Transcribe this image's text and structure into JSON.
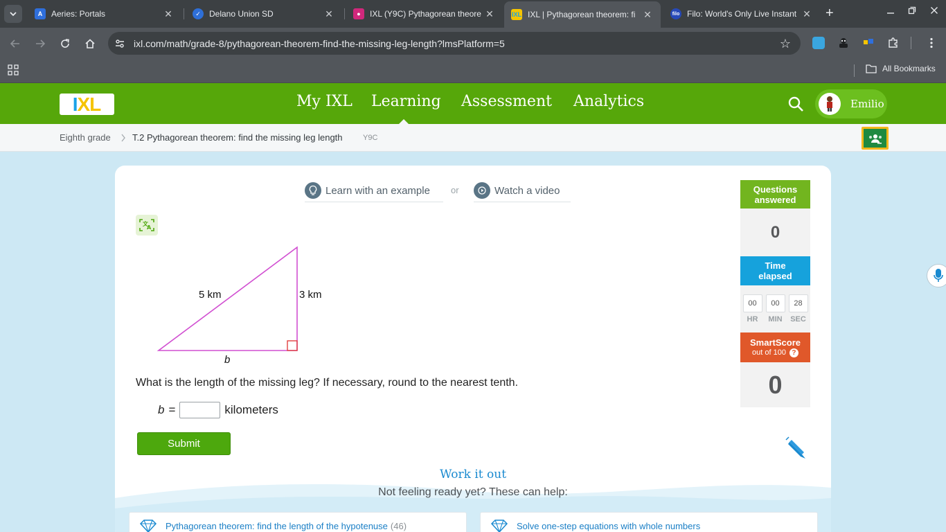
{
  "browser": {
    "tabs": [
      {
        "title": "Aeries: Portals",
        "active": false
      },
      {
        "title": "Delano Union SD",
        "active": false
      },
      {
        "title": "IXL (Y9C) Pythagorean theore",
        "active": false
      },
      {
        "title": "IXL | Pythagorean theorem: fi",
        "active": true
      },
      {
        "title": "Filo: World's Only Live Instant",
        "active": false
      }
    ],
    "url": "ixl.com/math/grade-8/pythagorean-theorem-find-the-missing-leg-length?lmsPlatform=5",
    "bookmarks_label": "All Bookmarks"
  },
  "header": {
    "nav": [
      "My IXL",
      "Learning",
      "Assessment",
      "Analytics"
    ],
    "active_nav": "Learning",
    "user_name": "Emilio"
  },
  "breadcrumb": {
    "grade": "Eighth grade",
    "skill": "T.2 Pythagorean theorem: find the missing leg length",
    "code": "Y9C"
  },
  "practice": {
    "learn_example": "Learn with an example",
    "or": "or",
    "watch_video": "Watch a video",
    "figure": {
      "hypotenuse_label": "5 km",
      "leg_label": "3 km",
      "unknown_label": "b"
    },
    "question": "What is the length of the missing leg? If necessary, round to the nearest tenth.",
    "answer_var": "b",
    "answer_eq": "=",
    "answer_value": "",
    "answer_unit": "kilometers",
    "submit_label": "Submit"
  },
  "work_it_out": {
    "title": "Work it out",
    "subtitle": "Not feeling ready yet? These can help:",
    "recommendations": [
      {
        "label": "Pythagorean theorem: find the length of the hypotenuse",
        "count": "(46)"
      },
      {
        "label": "Solve one-step equations with whole numbers",
        "count": ""
      }
    ]
  },
  "stats": {
    "questions_title_1": "Questions",
    "questions_title_2": "answered",
    "questions_value": "0",
    "time_title_1": "Time",
    "time_title_2": "elapsed",
    "time_hr": "00",
    "time_min": "00",
    "time_sec": "28",
    "hr_label": "HR",
    "min_label": "MIN",
    "sec_label": "SEC",
    "smartscore_title": "SmartScore",
    "smartscore_sub": "out of 100",
    "smartscore_help": "?",
    "smartscore_value": "0"
  },
  "colors": {
    "ixl_green": "#56a70a",
    "questions_header": "#72b51f",
    "time_header": "#16a2dc",
    "smartscore_header": "#e0582a",
    "triangle": "#d14fd1",
    "right_angle": "#e04040"
  }
}
